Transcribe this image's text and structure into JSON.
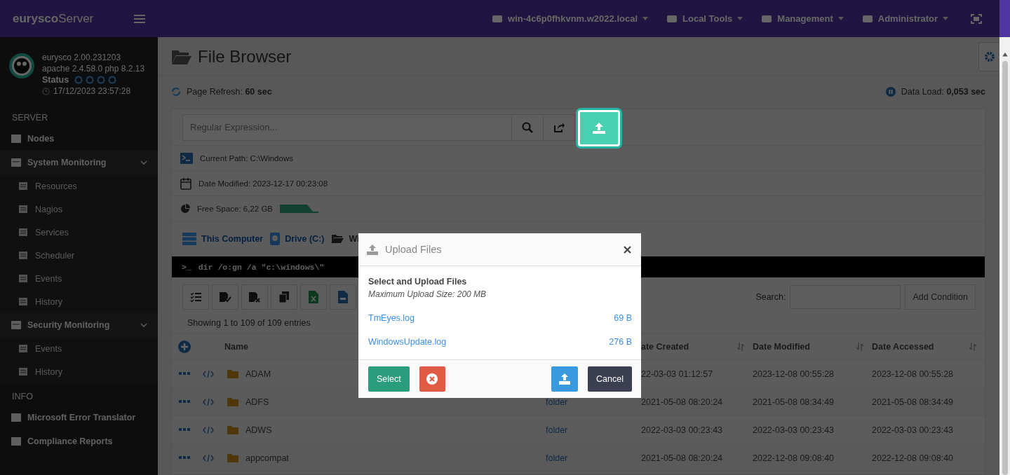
{
  "topbar": {
    "brand_bold": "eurysco",
    "brand_light": "Server",
    "menus": [
      {
        "label": "win-4c6p0fhkvnm.w2022.local"
      },
      {
        "label": "Local Tools"
      },
      {
        "label": "Management"
      },
      {
        "label": "Administrator"
      }
    ]
  },
  "sidebar": {
    "version": "eurysco 2.00.231203",
    "stack": "apache 2.4.58.0  php 8.2.13",
    "status_label": "Status",
    "timestamp": "17/12/2023 23:57:28",
    "sections": [
      {
        "heading": "SERVER",
        "items": [
          {
            "label": "Nodes",
            "kind": "link"
          },
          {
            "label": "System Monitoring",
            "kind": "group",
            "expanded": true,
            "children": [
              {
                "label": "Resources"
              },
              {
                "label": "Nagios"
              },
              {
                "label": "Services"
              },
              {
                "label": "Scheduler"
              },
              {
                "label": "Events"
              },
              {
                "label": "History"
              }
            ]
          },
          {
            "label": "Security Monitoring",
            "kind": "group",
            "expanded": true,
            "children": [
              {
                "label": "Events"
              },
              {
                "label": "History"
              }
            ]
          }
        ]
      },
      {
        "heading": "INFO",
        "items": [
          {
            "label": "Microsoft Error Translator",
            "kind": "link"
          },
          {
            "label": "Compliance Reports",
            "kind": "link"
          }
        ]
      }
    ]
  },
  "page": {
    "title": "File Browser",
    "refresh_label": "Page Refresh:",
    "refresh_value": "60 sec",
    "load_label": "Data Load:",
    "load_value": "0,053 sec"
  },
  "search": {
    "placeholder": "Regular Expression..."
  },
  "info": [
    {
      "label": "Current Path:",
      "value": "C:\\Windows",
      "kind": "path"
    },
    {
      "label": "Date Modified:",
      "value": "2023-12-17 00:23:08",
      "kind": "date"
    },
    {
      "label": "Free Space:",
      "value": "6,22 GB",
      "kind": "space"
    }
  ],
  "breadcrumb": [
    {
      "label": "This Computer",
      "kind": "computer"
    },
    {
      "label": "Drive (C:)",
      "kind": "drive"
    },
    {
      "label": "Wi",
      "kind": "folder"
    }
  ],
  "command_prompt": ">_",
  "command": "dir /o:gn /a \"c:\\windows\\\"",
  "table": {
    "entries_info": "Showing 1 to 109 of 109 entries",
    "search_label": "Search:",
    "add_condition": "Add Condition",
    "columns": [
      "Name",
      "ate Created",
      "Date Modified",
      "Date Accessed"
    ],
    "rows": [
      {
        "name": "ADAM",
        "created": "22-03-03 01:12:57",
        "modified": "2023-12-08 00:55:28",
        "accessed": "2023-12-08 00:55:28"
      },
      {
        "name": "ADFS",
        "type": "folder",
        "created": "2021-05-08 08:20:24",
        "modified": "2021-05-08 08:34:49",
        "accessed": "2021-05-08 08:34:49"
      },
      {
        "name": "ADWS",
        "type": "folder",
        "created": "2022-03-03 00:23:43",
        "modified": "2022-03-03 00:23:43",
        "accessed": "2022-03-03 00:23:43"
      },
      {
        "name": "appcompat",
        "type": "folder",
        "created": "2021-05-08 08:20:24",
        "modified": "2022-12-08 09:08:40",
        "accessed": "2022-12-08 09:08:40"
      }
    ]
  },
  "modal": {
    "title": "Upload Files",
    "heading": "Select and Upload Files",
    "note": "Maximum Upload Size: 200 MB",
    "files": [
      {
        "name": "TmEyes.log",
        "size": "69 B"
      },
      {
        "name": "WindowsUpdate.log",
        "size": "276 B"
      }
    ],
    "select_button": "Select",
    "cancel_button": "Cancel"
  }
}
